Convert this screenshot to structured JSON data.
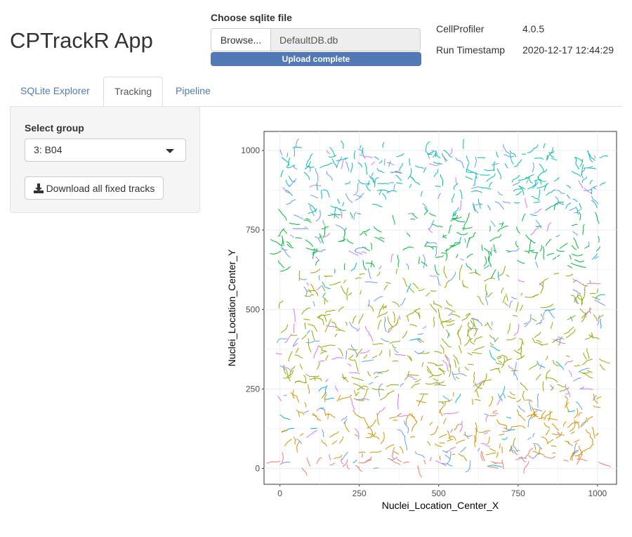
{
  "app": {
    "title": "CPTrackR App"
  },
  "file_input": {
    "label": "Choose sqlite file",
    "browse_label": "Browse...",
    "filename": "DefaultDB.db",
    "progress_text": "Upload complete",
    "progress": 100
  },
  "meta": {
    "rows": [
      {
        "key": "CellProfiler",
        "value": "4.0.5"
      },
      {
        "key": "Run Timestamp",
        "value": "2020-12-17 12:44:29"
      }
    ]
  },
  "tabs": [
    {
      "label": "SQLite Explorer",
      "active": false
    },
    {
      "label": "Tracking",
      "active": true
    },
    {
      "label": "Pipeline",
      "active": false
    }
  ],
  "sidebar": {
    "select_label": "Select group",
    "select_value": "3: B04",
    "download_label": "Download all fixed tracks",
    "download_icon": "download-icon"
  },
  "chart_data": {
    "type": "line",
    "xlabel": "Nuclei_Location_Center_X",
    "ylabel": "Nuclei_Location_Center_Y",
    "xlim": [
      -50,
      1060
    ],
    "ylim": [
      -50,
      1060
    ],
    "xticks": [
      "0",
      "250",
      "500",
      "750",
      "1000"
    ],
    "yticks": [
      "0",
      "250",
      "500",
      "750",
      "1000"
    ],
    "grid": true,
    "legend": "none",
    "palette": [
      "#f8766d",
      "#d39200",
      "#93aa00",
      "#00ba38",
      "#00c19f",
      "#00b9e3",
      "#619cff",
      "#db72fb",
      "#ff61c3"
    ]
  }
}
